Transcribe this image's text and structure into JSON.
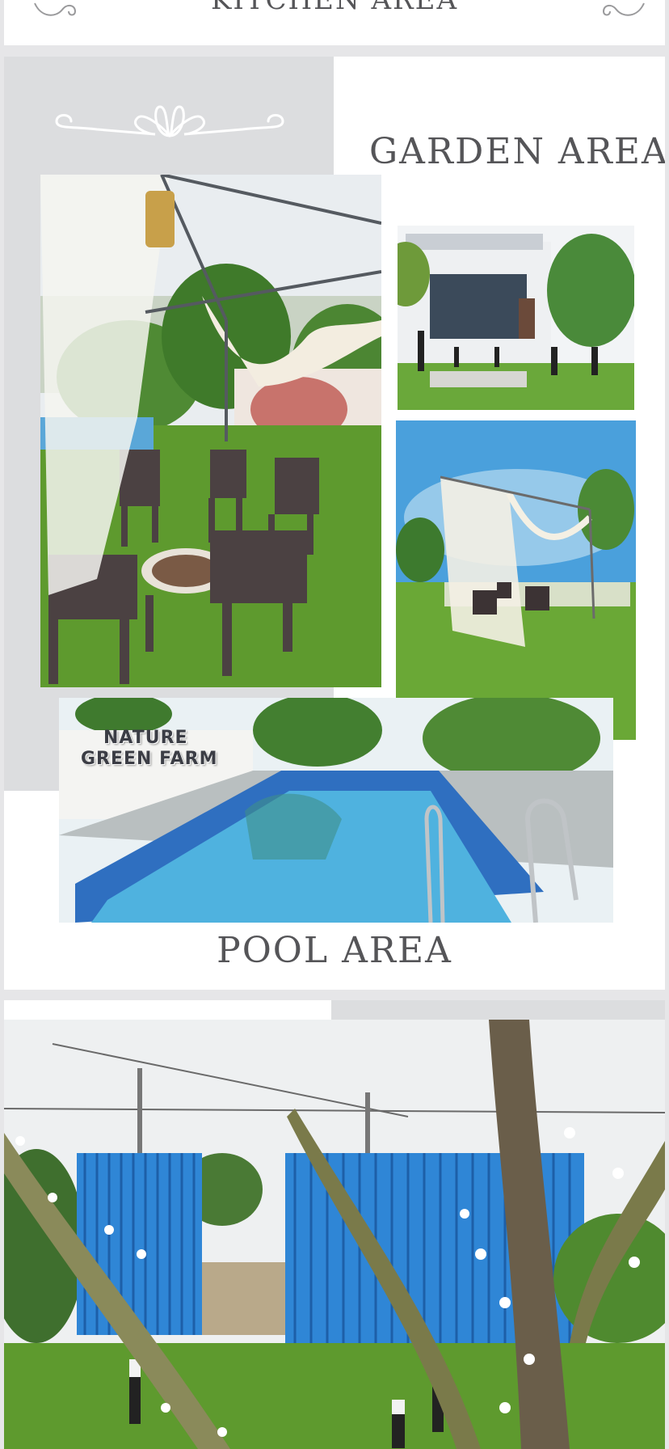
{
  "page1": {
    "title": "KITCHEN AREA"
  },
  "page2": {
    "garden_title": "GARDEN AREA",
    "pool_title": "POOL AREA",
    "pool_sign": {
      "line1": "NATURE",
      "line2": "GREEN FARM"
    }
  },
  "colors": {
    "heading": "#555558",
    "grey_block": "#dcdddf",
    "page_background": "#e6e6e8",
    "gate_blue": "#2f86d6",
    "pool_blue": "#3fa7d6",
    "grass": "#5e9a2e"
  },
  "icons": [
    "flourish-ornament",
    "flourish-ornament-small"
  ]
}
